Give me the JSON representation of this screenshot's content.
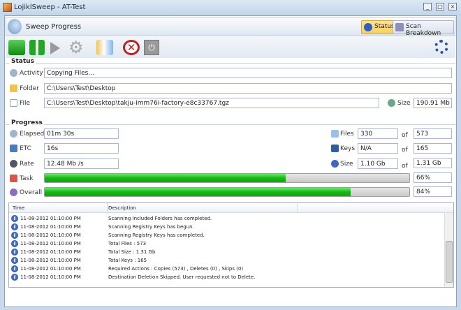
{
  "window": {
    "title": "LojiklSweep - AT-Test"
  },
  "ribbon": {
    "title": "Sweep Progress",
    "tabs": [
      {
        "label": "Status",
        "active": true
      },
      {
        "label": "Scan Breakdown",
        "active": false
      }
    ]
  },
  "toolbar": {
    "buttons": [
      "stop",
      "pause",
      "play",
      "settings",
      "open-log",
      "cancel",
      "power"
    ]
  },
  "status": {
    "heading": "Status",
    "activity_label": "Activity",
    "activity": "Copying Files...",
    "folder_label": "Folder",
    "folder": "C:\\Users\\Test\\Desktop",
    "file_label": "File",
    "file": "C:\\Users\\Test\\Desktop\\takju-imm76i-factory-e8c33767.tgz",
    "size_label": "Size",
    "size": "190.91 Mb"
  },
  "progress": {
    "heading": "Progress",
    "elapsed_label": "Elapsed",
    "elapsed": "01m 30s",
    "etc_label": "ETC",
    "etc": "16s",
    "rate_label": "Rate",
    "rate": "12.48 Mb /s",
    "files_label": "Files",
    "files": "330",
    "files_total": "573",
    "keys_label": "Keys",
    "keys": "N/A",
    "keys_total": "165",
    "size_label": "Size",
    "size": "1.10 Gb",
    "size_total": "1.31 Gb",
    "of": "of",
    "task_label": "Task",
    "task_percent": 66,
    "task_text": "66%",
    "overall_label": "Overall",
    "overall_percent": 84,
    "overall_text": "84%"
  },
  "log": {
    "columns": [
      "Time",
      "Description"
    ],
    "rows": [
      {
        "time": "11-08-2012 01:10:00 PM",
        "desc": "Scanning Included Folders has completed."
      },
      {
        "time": "11-08-2012 01:10:00 PM",
        "desc": "Scanning Registry Keys has begun."
      },
      {
        "time": "11-08-2012 01:10:00 PM",
        "desc": "Scanning Registry Keys has completed."
      },
      {
        "time": "11-08-2012 01:10:00 PM",
        "desc": "Total Files : 573"
      },
      {
        "time": "11-08-2012 01:10:00 PM",
        "desc": "Total Size  : 1.31 Gb"
      },
      {
        "time": "11-08-2012 01:10:00 PM",
        "desc": "Total Keys  : 165"
      },
      {
        "time": "11-08-2012 01:10:00 PM",
        "desc": "Required Actions : Copies (573) , Deletes (0) , Skips (0)"
      },
      {
        "time": "11-08-2012 01:10:00 PM",
        "desc": "Destination Deletion Skipped. User requested not to Delete."
      }
    ]
  }
}
